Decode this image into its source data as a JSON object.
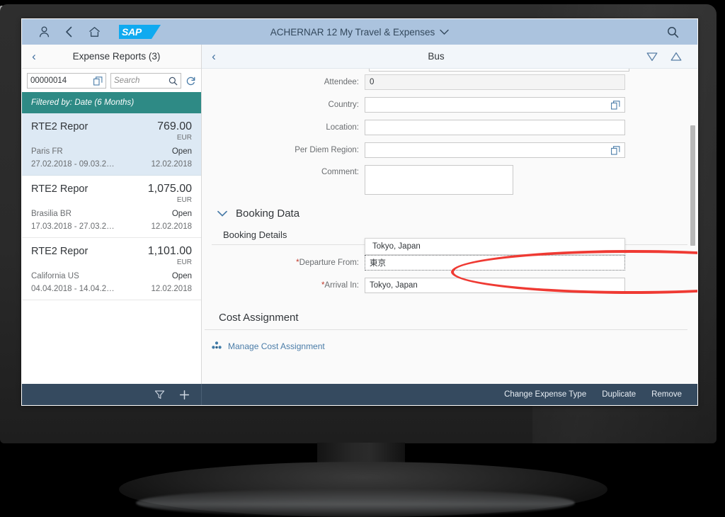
{
  "shellbar": {
    "title": "ACHERNAR 12 My Travel & Expenses",
    "chevron": "⌄",
    "logo_text": "SAP",
    "icons": {
      "user": "user-icon",
      "back": "back-icon",
      "home": "home-icon",
      "search": "search-icon"
    }
  },
  "master": {
    "back": "‹",
    "title": "Expense Reports (3)",
    "id_field": {
      "value": "00000014",
      "icon": "value-help-icon"
    },
    "search_field": {
      "placeholder": "Search",
      "icon": "search-icon"
    },
    "refresh_icon": "refresh-icon",
    "filter_banner": "Filtered by: Date (6 Months)",
    "items": [
      {
        "title": "RTE2 Repor",
        "amount": "769.00",
        "currency": "EUR",
        "location": "Paris FR",
        "status": "Open",
        "range": "27.02.2018 - 09.03.2…",
        "date": "12.02.2018",
        "selected": true
      },
      {
        "title": "RTE2 Repor",
        "amount": "1,075.00",
        "currency": "EUR",
        "location": "Brasilia BR",
        "status": "Open",
        "range": "17.03.2018 - 27.03.2…",
        "date": "12.02.2018",
        "selected": false
      },
      {
        "title": "RTE2 Repor",
        "amount": "1,101.00",
        "currency": "EUR",
        "location": "California US",
        "status": "Open",
        "range": "04.04.2018 - 14.04.2…",
        "date": "12.02.2018",
        "selected": false
      }
    ]
  },
  "detail": {
    "back": "‹",
    "title": "Bus",
    "nav_down_icon": "triangle-down-icon",
    "nav_up_icon": "triangle-up-icon",
    "fields": {
      "attendee_label": "Attendee:",
      "attendee_value": "0",
      "country_label": "Country:",
      "country_value": "",
      "location_label": "Location:",
      "location_value": "",
      "per_diem_label": "Per Diem Region:",
      "per_diem_value": "",
      "comment_label": "Comment:"
    },
    "booking_data": {
      "chevron": "⌄",
      "label": "Booking Data",
      "details_title": "Booking Details",
      "departure_label": "Departure From:",
      "departure_value": "東京",
      "departure_suggestion": "Tokyo, Japan",
      "arrival_label": "Arrival In:",
      "arrival_value": "Tokyo, Japan",
      "required_marker": "*"
    },
    "cost_assignment": {
      "title": "Cost Assignment",
      "link": "Manage Cost Assignment",
      "icon": "cost-assignment-icon"
    }
  },
  "footer": {
    "filter_icon": "filter-icon",
    "add_icon": "add-icon",
    "buttons": [
      "Change Expense Type",
      "Duplicate",
      "Remove"
    ]
  },
  "colors": {
    "shellbar": "#abc3de",
    "filter_banner": "#2e8a85",
    "footer": "#354a5f",
    "accent_link": "#4a7ca8",
    "annotation": "#ef3a33",
    "selected_row": "#dde9f4"
  }
}
